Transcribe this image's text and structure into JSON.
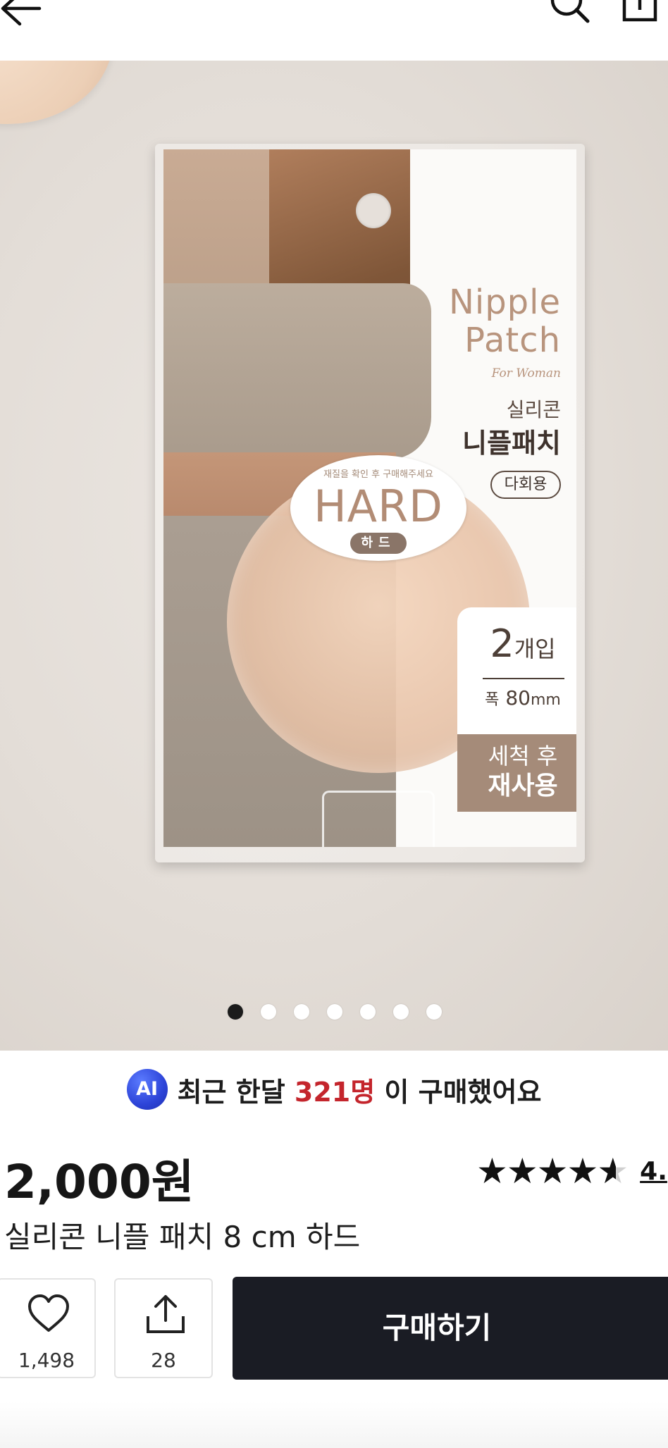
{
  "header": {
    "back_icon": "arrow-left-icon",
    "search_icon": "search-icon",
    "share_icon": "share-box-icon"
  },
  "gallery": {
    "image": {
      "brand_title": "Nipple Patch",
      "for_text": "For Woman",
      "ko_small": "실리콘",
      "ko_big": "니플패치",
      "multi_use": "다회용",
      "badge_note": "재질을 확인 후 구매해주세요",
      "badge_hard": "HARD",
      "badge_ko": "하드",
      "count_num": "2",
      "count_unit": "개입",
      "width_label": "폭",
      "width_value": "80",
      "width_unit": "mm",
      "reuse_line1": "세척 후",
      "reuse_line2": "재사용"
    },
    "page_count": 7,
    "active_index": 0
  },
  "ai_notice": {
    "badge": "AI",
    "prefix": "최근 한달 ",
    "count": "321명",
    "suffix": " 이 구매했어요"
  },
  "product": {
    "price": "2,000원",
    "rating": {
      "stars": 4.8,
      "value": "4."
    },
    "title": "실리콘 니플 패치 8 cm 하드"
  },
  "bottom_bar": {
    "like_icon": "heart-icon",
    "like_count": "1,498",
    "share_icon": "share-upload-icon",
    "share_count": "28",
    "buy_label": "구매하기"
  },
  "colors": {
    "highlight_red": "#c4252c",
    "buy_button": "#1a1c24",
    "ai_badge": "#2d44d8",
    "active_dot": "#1b1b1b"
  }
}
